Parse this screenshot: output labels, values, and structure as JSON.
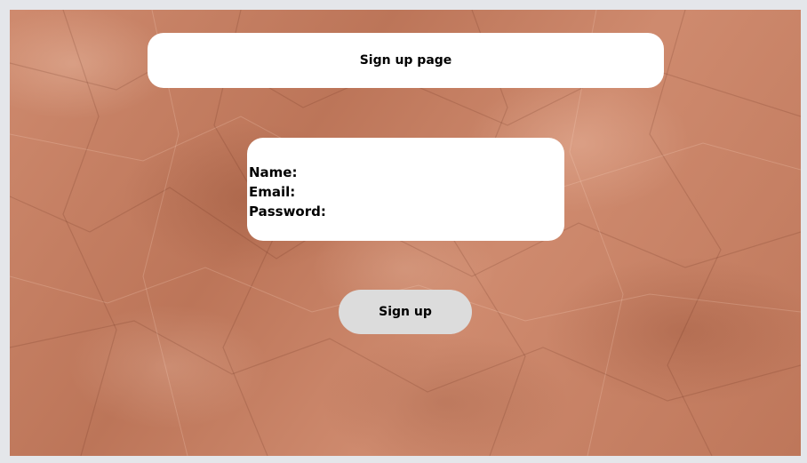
{
  "header": {
    "title": "Sign up page"
  },
  "form": {
    "labels": [
      "Name:",
      "Email:",
      "Password:"
    ]
  },
  "actions": {
    "signup_label": "Sign up"
  },
  "colors": {
    "page_background": "#e4e6ea",
    "paper": "#c98063",
    "panel": "#ffffff",
    "button": "#dcdcdc",
    "text": "#000000"
  }
}
